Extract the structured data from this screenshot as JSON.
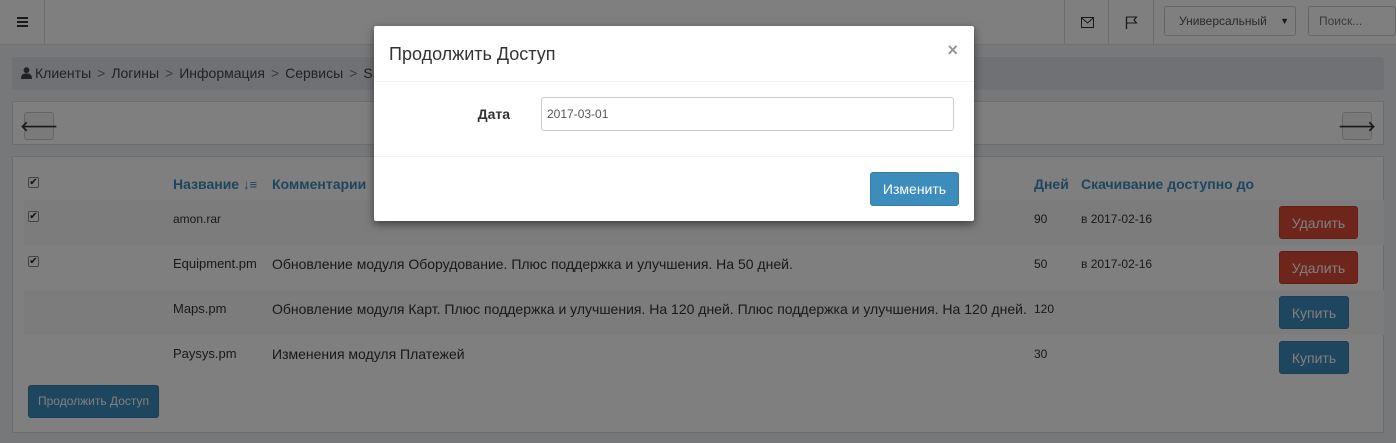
{
  "topbar": {
    "language_select": "Универсальный",
    "search_placeholder": "Поиск..."
  },
  "breadcrumb": {
    "items": [
      "Клиенты",
      "Логины",
      "Информация",
      "Сервисы",
      "S"
    ],
    "separator": ">"
  },
  "table": {
    "headers": {
      "name": "Название",
      "comments": "Комментарии",
      "days": "Дней",
      "download": "Скачивание доступно до"
    },
    "rows": [
      {
        "checked": true,
        "name": "amon.rar",
        "comment": "",
        "days": "90",
        "download": "в 2017-02-16",
        "action": "Удалить"
      },
      {
        "checked": true,
        "name": "Equipment.pm",
        "comment": "Обновление модуля Оборудование. Плюс поддержка и улучшения. На 50 дней.",
        "days": "50",
        "download": "в 2017-02-16",
        "action": "Удалить"
      },
      {
        "checked": false,
        "name": "Maps.pm",
        "comment": "Обновление модуля Карт. Плюс поддержка и улучшения. На 120 дней. Плюс поддержка и улучшения. На 120 дней.",
        "days": "120",
        "download": "",
        "action": "Купить"
      },
      {
        "checked": false,
        "name": "Paysys.pm",
        "comment": "Изменения модуля Платежей",
        "days": "30",
        "download": "",
        "action": "Купить"
      }
    ]
  },
  "continue_button": "Продолжить Доступ",
  "modal": {
    "title": "Продолжить Доступ",
    "close": "×",
    "date_label": "Дата",
    "date_value": "2017-03-01",
    "submit": "Изменить"
  },
  "colors": {
    "primary": "#3c8dbc",
    "danger": "#dd4b39",
    "page_bg": "#ecf0f5"
  }
}
